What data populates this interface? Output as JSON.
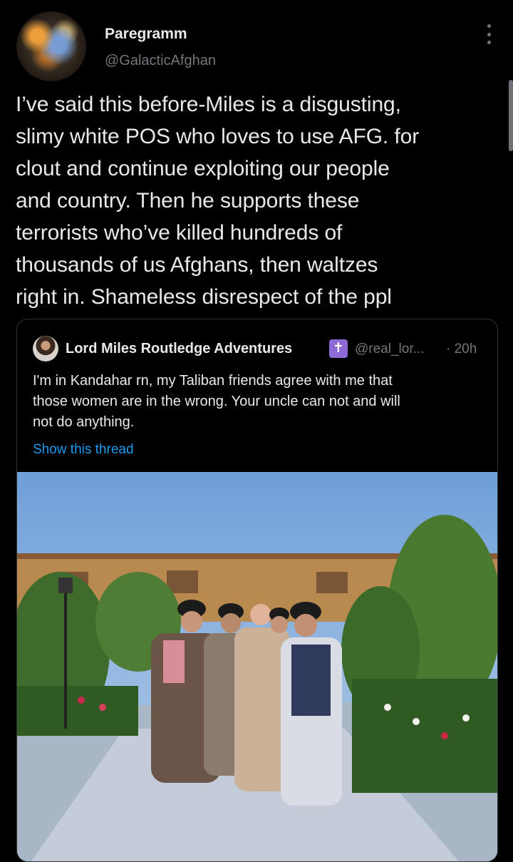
{
  "author": {
    "display_name": "Paregramm",
    "handle": "@GalacticAfghan"
  },
  "tweet": {
    "lines": [
      "I’ve said this before-Miles is a disgusting,",
      "slimy white POS who loves to use AFG. for",
      "clout and continue exploiting our people",
      "and country. Then he supports these",
      "terrorists who’ve killed hundreds of",
      "thousands of us Afghans, then waltzes",
      "right in. Shameless disrespect of the ppl"
    ]
  },
  "quoted_tweet": {
    "author_name": "Lord Miles Routledge Adventures",
    "badge_glyph": "✝",
    "handle": "@real_lor...",
    "time": "· 20h",
    "lines": [
      "I'm in Kandahar rn, my Taliban friends agree with me that",
      "those women are in the wrong. Your uncle can not and will",
      "not do anything."
    ],
    "show_thread_label": "Show this thread",
    "photo_description": "photo-group-of-five-men-in-courtyard"
  },
  "colors": {
    "background": "#000000",
    "text": "#e7e9ea",
    "secondary_text": "#71767b",
    "link": "#1d9bf0",
    "border": "#2f3336",
    "badge": "#8e6ad6"
  },
  "icons": {
    "more": "more-vertical-icon"
  }
}
